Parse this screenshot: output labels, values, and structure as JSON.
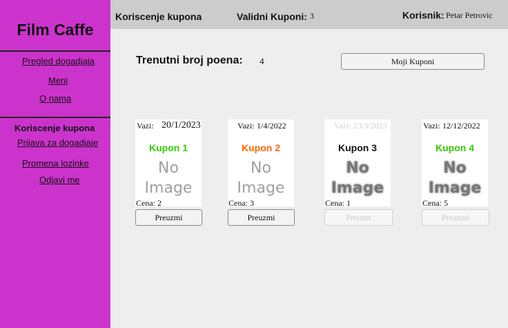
{
  "sidebar": {
    "brand": "Film Caffe",
    "links": {
      "pregled": "Pregled dogadjaja",
      "meni": "Meni",
      "o_nama": "O nama",
      "current": "Koriscenje kupona",
      "prijava": "Prijava za dogadjaje",
      "promena": "Promena lozinke",
      "odjavi": "Odjavi me"
    }
  },
  "topbar": {
    "title": "Koriscenje kupona",
    "valid_label": "Validni Kuponi:",
    "valid_count": "3",
    "user_label": "Korisnik:",
    "user_name": "Petar Petrovic"
  },
  "main": {
    "points_label": "Trenutni broj poena:",
    "points_value": "4",
    "my_coupons_button": "Moji Kuponi"
  },
  "coupons": [
    {
      "valid_label": "Vazi:",
      "date": "20/1/2023",
      "name": "Kupon 1",
      "name_color": "#33cc00",
      "image_text_1": "No",
      "image_text_2": "Image",
      "price": "Cena: 2",
      "button": "Preuzmi",
      "enabled": true
    },
    {
      "valid_label": "Vazi:",
      "date": "1/4/2022",
      "name": "Kupon 2",
      "name_color": "#ff6600",
      "image_text_1": "No",
      "image_text_2": "Image",
      "price": "Cena: 3",
      "button": "Preuzmi",
      "enabled": true
    },
    {
      "valid_label": "Vazi:",
      "date": "23/3/2023",
      "name": "Kupon 3",
      "name_color": "#111111",
      "image_text_1": "No",
      "image_text_2": "Image",
      "price": "Cena: 1",
      "button": "Preuzet",
      "enabled": false
    },
    {
      "valid_label": "Vazi:",
      "date": "12/12/2022",
      "name": "Kupon 4",
      "name_color": "#33cc00",
      "image_text_1": "No",
      "image_text_2": "Image",
      "price": "Cena: 5",
      "button": "Preuzmi",
      "enabled": false
    }
  ]
}
